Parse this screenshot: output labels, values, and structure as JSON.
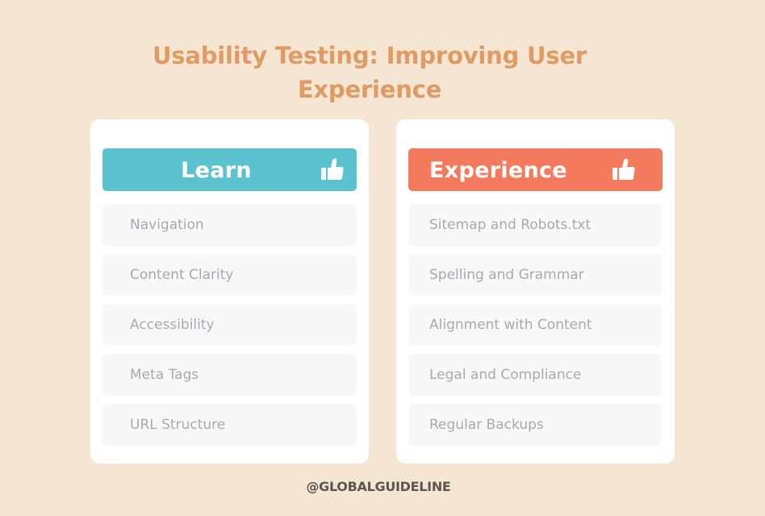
{
  "title": {
    "line1": "Usability Testing: Improving User",
    "line2": "Experience"
  },
  "cards": [
    {
      "header": "Learn",
      "header_color": "#5bc2cf",
      "icon": "thumbs-up-icon",
      "items": [
        "Navigation",
        "Content Clarity",
        "Accessibility",
        "Meta Tags",
        "URL Structure"
      ]
    },
    {
      "header": "Experience",
      "header_color": "#f37a5c",
      "icon": "thumbs-up-icon",
      "items": [
        "Sitemap and Robots.txt",
        "Spelling and Grammar",
        "Alignment with Content",
        "Legal and Compliance",
        "Regular Backups"
      ]
    }
  ],
  "footer": {
    "handle": "@GLOBALGUIDELINE"
  },
  "colors": {
    "background": "#f4e6d2",
    "title": "#e09a63",
    "item_text": "#a9a9ad",
    "footer_text": "#5e5550"
  }
}
